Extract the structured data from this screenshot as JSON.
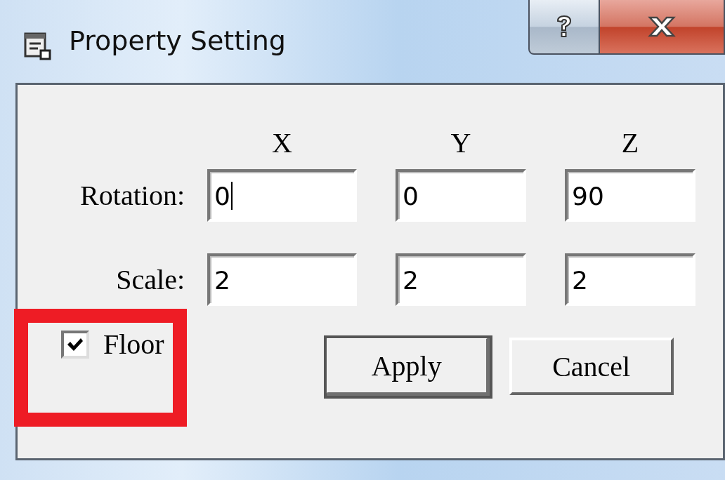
{
  "window": {
    "title": "Property Setting"
  },
  "columns": [
    "X",
    "Y",
    "Z"
  ],
  "rows": [
    {
      "label": "Rotation:",
      "fields": [
        {
          "value": "0",
          "focused": true
        },
        {
          "value": "0",
          "focused": false
        },
        {
          "value": "90",
          "focused": false
        }
      ]
    },
    {
      "label": "Scale:",
      "fields": [
        {
          "value": "2",
          "focused": false
        },
        {
          "value": "2",
          "focused": false
        },
        {
          "value": "2",
          "focused": false
        }
      ]
    }
  ],
  "floor_checkbox": {
    "label": "Floor",
    "checked": true
  },
  "buttons": [
    {
      "label": "Apply",
      "default": true
    },
    {
      "label": "Cancel",
      "default": false
    }
  ]
}
